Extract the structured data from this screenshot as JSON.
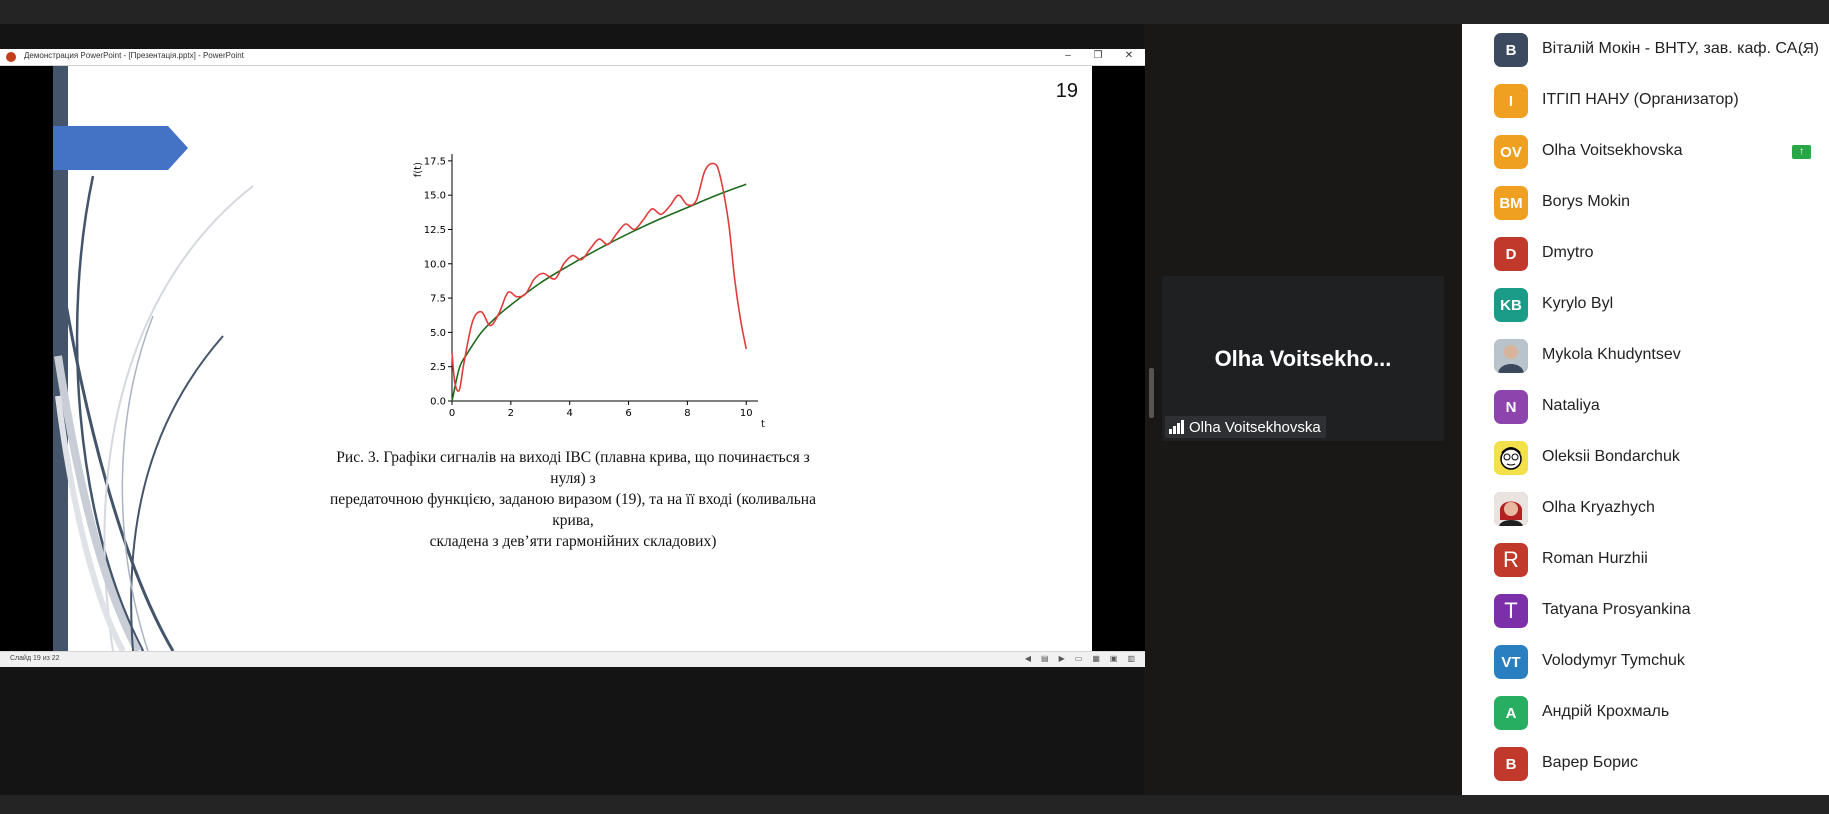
{
  "window": {
    "title": "Демонстрация PowerPoint - [Презентація.pptx] - PowerPoint",
    "minimize": "–",
    "restore": "❐",
    "close": "✕"
  },
  "slide": {
    "number": "19",
    "caption_lines": [
      "Рис. 3.  Графіки сигналів на виході ІВС (плавна крива, що починається з нуля) з",
      "передаточною функцією, заданою виразом (19), та на її вході (коливальна крива,",
      "складена з дев’яти гармонійних складових)"
    ]
  },
  "status_bar": {
    "slide_counter": "Слайд 19 из 22"
  },
  "chart_data": {
    "type": "line",
    "title": "",
    "xlabel": "t",
    "ylabel": "f(t)",
    "xlim": [
      0,
      10.4
    ],
    "ylim": [
      0,
      18
    ],
    "xticks": [
      "0",
      "2",
      "4",
      "6",
      "8",
      "10"
    ],
    "yticks": [
      "0.0",
      "2.5",
      "5.0",
      "7.5",
      "10.0",
      "12.5",
      "15.0",
      "17.5"
    ],
    "series": [
      {
        "color": "#1e6b1e",
        "x": [
          0,
          0.25,
          0.5,
          1,
          1.5,
          2,
          3,
          4,
          5,
          6,
          7,
          8,
          9,
          10
        ],
        "y": [
          0,
          2.4,
          3.4,
          5.0,
          6.1,
          7.0,
          8.6,
          9.9,
          11.1,
          12.2,
          13.2,
          14.1,
          15.0,
          15.8
        ]
      },
      {
        "color": "#e23b3b",
        "x": [
          0,
          0.1,
          0.25,
          0.4,
          0.7,
          1.0,
          1.3,
          1.6,
          1.9,
          2.2,
          2.5,
          2.8,
          3.1,
          3.5,
          3.8,
          4.1,
          4.4,
          4.7,
          5.0,
          5.3,
          5.6,
          5.9,
          6.2,
          6.5,
          6.8,
          7.1,
          7.4,
          7.7,
          8.0,
          8.3,
          8.6,
          8.9,
          9.1,
          9.4,
          9.6,
          9.8,
          10.0
        ],
        "y": [
          3.5,
          1.3,
          0.8,
          2.7,
          5.8,
          6.5,
          5.5,
          6.4,
          7.9,
          7.6,
          7.8,
          8.9,
          9.3,
          8.9,
          10.0,
          10.6,
          10.3,
          11.1,
          11.8,
          11.4,
          12.2,
          12.9,
          12.5,
          13.2,
          14.0,
          13.6,
          14.2,
          15.0,
          14.3,
          14.6,
          16.8,
          17.3,
          16.5,
          13.0,
          9.0,
          6.0,
          3.8
        ]
      }
    ]
  },
  "video": {
    "display_name": "Olha  Voitsekho...",
    "label": "Olha Voitsekhovska"
  },
  "participants": [
    {
      "initials": "B",
      "name": "Віталій Мокін - ВНТУ, зав. каф. СА...",
      "tag": "(Я)",
      "color": "#3b4a5e"
    },
    {
      "initials": "I",
      "name": "ІТГІП НАНУ (Организатор)",
      "color": "#f0a020"
    },
    {
      "initials": "OV",
      "name": "Olha Voitsekhovska",
      "color": "#f0a020",
      "badge": "↑"
    },
    {
      "initials": "BM",
      "name": "Borys Mokin",
      "color": "#f0a020"
    },
    {
      "initials": "D",
      "name": "Dmytro",
      "color": "#c0392b"
    },
    {
      "initials": "KB",
      "name": "Kyrylo Byl",
      "color": "#1a9c88"
    },
    {
      "initials": "",
      "name": "Mykola Khudyntsev",
      "color": "#8a8f96",
      "photo": "man-photo"
    },
    {
      "initials": "N",
      "name": "Nataliya",
      "color": "#8e44ad"
    },
    {
      "initials": "",
      "name": "Oleksii Bondarchuk",
      "color": "#f2e14a",
      "photo": "cartoon-photo"
    },
    {
      "initials": "",
      "name": "Olha Kryazhych",
      "color": "#b04a3a",
      "photo": "woman-photo"
    },
    {
      "initials": "R",
      "name": "Roman Hurzhii",
      "color": "#c0392b",
      "thin": true
    },
    {
      "initials": "T",
      "name": "Tatyana Prosyankina",
      "color": "#7b2fa8",
      "thin": true
    },
    {
      "initials": "VT",
      "name": "Volodymyr Tymchuk",
      "color": "#2a7fc1"
    },
    {
      "initials": "A",
      "name": "Андрій Крохмаль",
      "color": "#27ae60"
    },
    {
      "initials": "B",
      "name": "Варер Борис",
      "color": "#c0392b"
    }
  ]
}
